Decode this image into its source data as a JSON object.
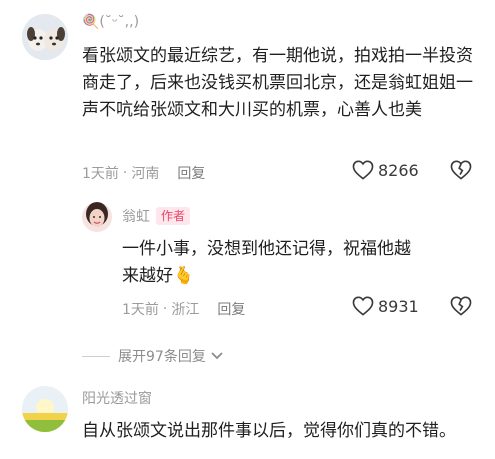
{
  "comment1": {
    "username": "🍭(˘ᵕ˘,,)",
    "text": "看张颂文的最近综艺，有一期他说，拍戏拍一半投资商走了，后来也没钱买机票回北京，还是翁虹姐姐一声不吭给张颂文和大川买的机票，心善人也美",
    "time": "1天前",
    "separator": "·",
    "location": "河南",
    "reply_label": "回复",
    "likes": "8266"
  },
  "reply1": {
    "username": "翁虹",
    "author_badge": "作者",
    "text": "一件小事，没想到他还记得，祝福他越来越好🫰",
    "time": "1天前",
    "separator": "·",
    "location": "浙江",
    "reply_label": "回复",
    "likes": "8931"
  },
  "expand": {
    "label": "展开97条回复"
  },
  "comment2": {
    "username": "阳光透过窗",
    "text": "自从张颂文说出那件事以后，觉得你们真的不错。"
  }
}
